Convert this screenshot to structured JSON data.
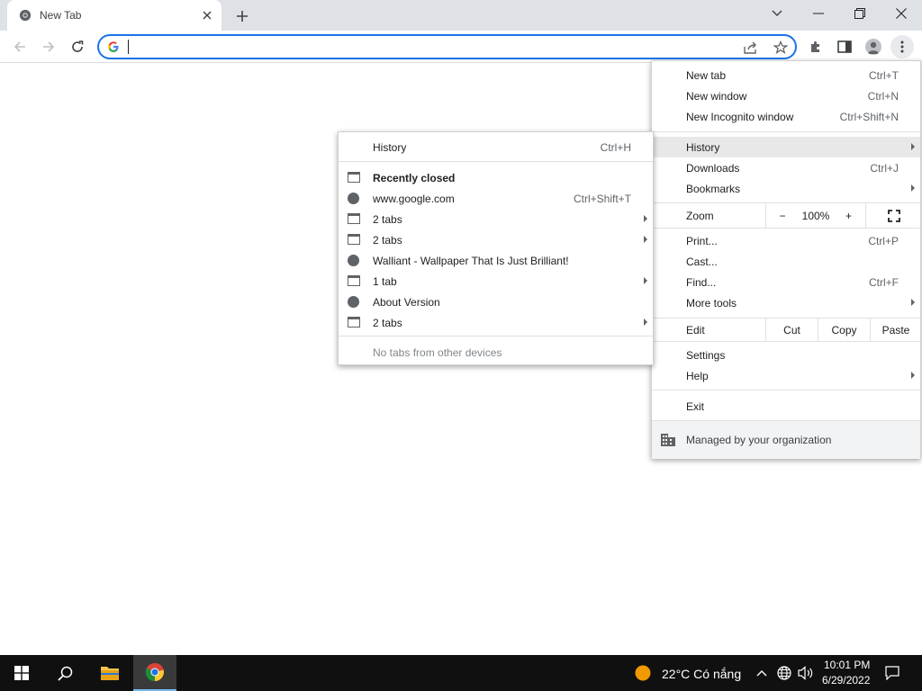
{
  "tab": {
    "title": "New Tab"
  },
  "omnibox": {
    "value": ""
  },
  "chrome_menu": {
    "top_items": [
      {
        "label": "New tab",
        "shortcut": "Ctrl+T"
      },
      {
        "label": "New window",
        "shortcut": "Ctrl+N"
      },
      {
        "label": "New Incognito window",
        "shortcut": "Ctrl+Shift+N"
      }
    ],
    "history": {
      "label": "History"
    },
    "downloads": {
      "label": "Downloads",
      "shortcut": "Ctrl+J"
    },
    "bookmarks": {
      "label": "Bookmarks"
    },
    "zoom": {
      "label": "Zoom",
      "minus": "−",
      "value": "100%",
      "plus": "+"
    },
    "print": {
      "label": "Print...",
      "shortcut": "Ctrl+P"
    },
    "cast": {
      "label": "Cast..."
    },
    "find": {
      "label": "Find...",
      "shortcut": "Ctrl+F"
    },
    "more_tools": {
      "label": "More tools"
    },
    "edit": {
      "label": "Edit",
      "cut": "Cut",
      "copy": "Copy",
      "paste": "Paste"
    },
    "settings": {
      "label": "Settings"
    },
    "help": {
      "label": "Help"
    },
    "exit": {
      "label": "Exit"
    },
    "managed": {
      "label": "Managed by your organization"
    }
  },
  "history_menu": {
    "history": {
      "label": "History",
      "shortcut": "Ctrl+H"
    },
    "recently_closed": "Recently closed",
    "items": [
      {
        "icon": "tab-icon",
        "label": "Recently closed"
      },
      {
        "icon": "globe-icon",
        "label": "www.google.com",
        "shortcut": "Ctrl+Shift+T"
      },
      {
        "icon": "tab-icon",
        "label": "2 tabs"
      },
      {
        "icon": "tab-icon",
        "label": "2 tabs"
      },
      {
        "icon": "globe-icon",
        "label": "Walliant - Wallpaper That Is Just Brilliant!"
      },
      {
        "icon": "tab-icon",
        "label": "1 tab"
      },
      {
        "icon": "globe-icon",
        "label": "About Version"
      },
      {
        "icon": "tab-icon",
        "label": "2 tabs"
      }
    ],
    "footer": "No tabs from other devices"
  },
  "taskbar": {
    "weather": "22°C  Có nắng",
    "time": "10:01 PM",
    "date": "6/29/2022"
  },
  "colors": {
    "accent": "#1a73e8",
    "taskbar": "#101010",
    "tabstrip": "#dee1e6"
  }
}
